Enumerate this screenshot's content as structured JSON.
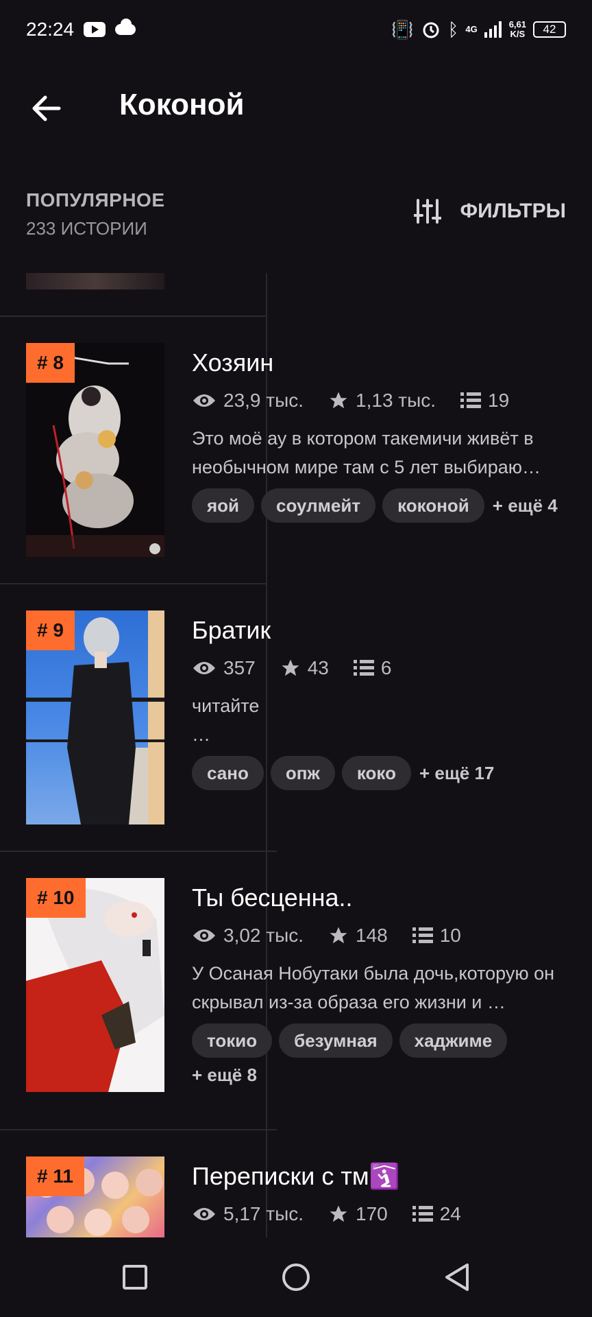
{
  "status_bar": {
    "time": "22:24",
    "network": "4G",
    "speed_value": "6,61",
    "speed_unit": "K/S",
    "battery": "42"
  },
  "header": {
    "title": "Коконой"
  },
  "sort": {
    "label": "ПОПУЛЯРНОЕ",
    "count": "233 ИСТОРИИ",
    "filter_label": "ФИЛЬТРЫ"
  },
  "stories": [
    {
      "rank": "# 8",
      "title": "Хозяин",
      "views": "23,9 тыс.",
      "votes": "1,13 тыс.",
      "parts": "19",
      "description": "Это моё ау в котором такемичи живёт в необычном мире там с 5 лет выбираю…",
      "tags": [
        "яой",
        "соулмейт",
        "коконой"
      ],
      "more": "+ ещё 4"
    },
    {
      "rank": "# 9",
      "title": "Братик",
      "views": "357",
      "votes": "43",
      "parts": "6",
      "description": "читайте\n…",
      "tags": [
        "сано",
        "опж",
        "коко"
      ],
      "more": "+ ещё 17"
    },
    {
      "rank": "# 10",
      "title": "Ты бесценна..",
      "views": "3,02 тыс.",
      "votes": "148",
      "parts": "10",
      "description": "У Осаная Нобутаки была дочь,которую он скрывал из-за образа его жизни и …",
      "tags": [
        "токио",
        "безумная",
        "хаджиме"
      ],
      "more": "+ ещё 8"
    },
    {
      "rank": "# 11",
      "title": "Переписки с тм🛐",
      "views": "5,17 тыс.",
      "votes": "170",
      "parts": "24"
    }
  ],
  "icons": {
    "back": "arrow-left-icon",
    "filter": "sliders-icon",
    "views": "eye-icon",
    "votes": "star-icon",
    "parts": "list-icon"
  },
  "colors": {
    "background": "#121014",
    "rank_badge": "#ff6d2e",
    "tag_bg": "#2e2c31"
  }
}
